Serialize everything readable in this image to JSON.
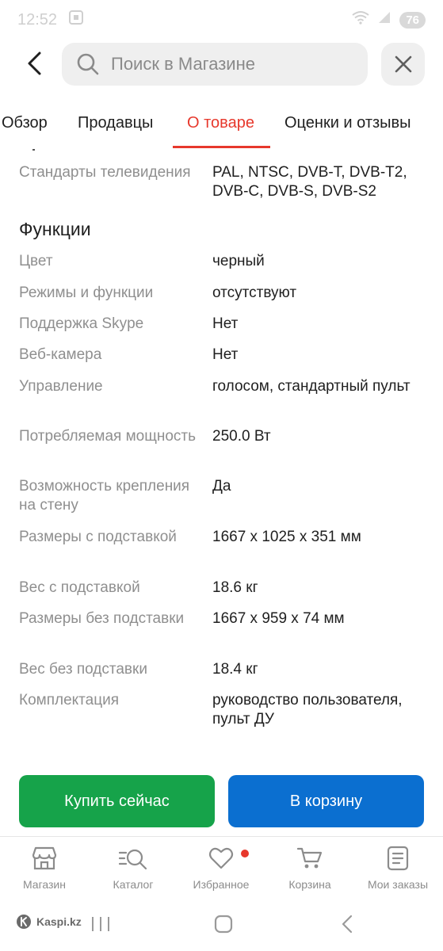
{
  "status": {
    "time": "12:52",
    "battery": "76"
  },
  "header": {
    "search_placeholder": "Поиск в Магазине"
  },
  "tabs": [
    {
      "label": "Обзор",
      "active": false
    },
    {
      "label": "Продавцы",
      "active": false
    },
    {
      "label": "О товаре",
      "active": true
    },
    {
      "label": "Оценки и отзывы",
      "active": false
    }
  ],
  "specs": {
    "top_row": {
      "key": "Стандарты телевидения",
      "value": "PAL, NTSC, DVB-T, DVB-T2, DVB-C, DVB-S, DVB-S2"
    },
    "section_title": "Функции",
    "rows": [
      {
        "key": "Цвет",
        "value": "черный"
      },
      {
        "key": "Режимы и функции",
        "value": "отсутствуют"
      },
      {
        "key": "Поддержка Skype",
        "value": "Нет"
      },
      {
        "key": "Веб-камера",
        "value": "Нет"
      },
      {
        "key": "Управление",
        "value": "голосом, стандартный пульт"
      },
      {
        "key": "Потребляемая мощность",
        "value": "250.0 Вт"
      },
      {
        "key": "Возможность крепления на стену",
        "value": "Да"
      },
      {
        "key": "Размеры с подставкой",
        "value": "1667 x 1025 x 351 мм"
      },
      {
        "key": "Вес с подставкой",
        "value": "18.6 кг"
      },
      {
        "key": "Размеры без подставки",
        "value": "1667 x 959 x 74 мм"
      },
      {
        "key": "Вес без подставки",
        "value": "18.4 кг"
      },
      {
        "key": "Комплектация",
        "value": "руководство пользователя, пульт ДУ"
      }
    ]
  },
  "actions": {
    "buy_now": "Купить сейчас",
    "add_to_cart": "В корзину"
  },
  "bottom_nav": [
    {
      "label": "Магазин",
      "icon": "store-icon"
    },
    {
      "label": "Каталог",
      "icon": "catalog-search-icon"
    },
    {
      "label": "Избранное",
      "icon": "heart-icon"
    },
    {
      "label": "Корзина",
      "icon": "cart-icon"
    },
    {
      "label": "Мои заказы",
      "icon": "orders-icon"
    }
  ],
  "system": {
    "brand": "Kaspi.kz"
  },
  "colors": {
    "accent": "#e7382c",
    "buy": "#16a34a",
    "cart": "#0b6fd0"
  }
}
